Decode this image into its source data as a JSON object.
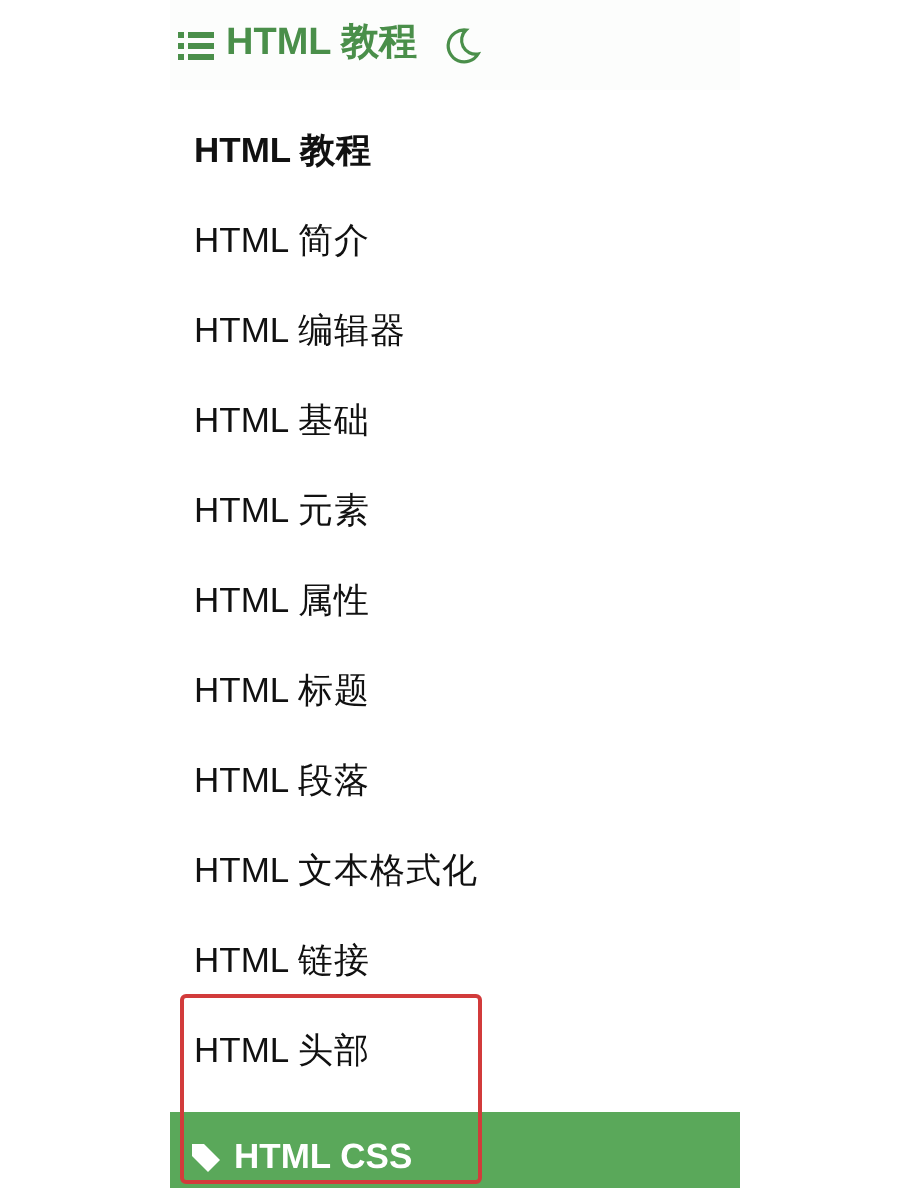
{
  "header": {
    "title": "HTML 教程"
  },
  "items": [
    {
      "label": "HTML 教程",
      "kind": "heading",
      "framed": false
    },
    {
      "label": "HTML 简介",
      "kind": "link",
      "framed": false
    },
    {
      "label": "HTML 编辑器",
      "kind": "link",
      "framed": false
    },
    {
      "label": "HTML 基础",
      "kind": "link",
      "framed": false
    },
    {
      "label": "HTML 元素",
      "kind": "link",
      "framed": false
    },
    {
      "label": "HTML 属性",
      "kind": "link",
      "framed": false
    },
    {
      "label": "HTML 标题",
      "kind": "link",
      "framed": false
    },
    {
      "label": "HTML 段落",
      "kind": "link",
      "framed": false
    },
    {
      "label": "HTML 文本格式化",
      "kind": "link",
      "framed": false
    },
    {
      "label": "HTML 链接",
      "kind": "link",
      "framed": false
    },
    {
      "label": "HTML 头部",
      "kind": "link",
      "framed": true
    },
    {
      "label": "HTML CSS",
      "kind": "banner",
      "framed": true
    }
  ]
}
